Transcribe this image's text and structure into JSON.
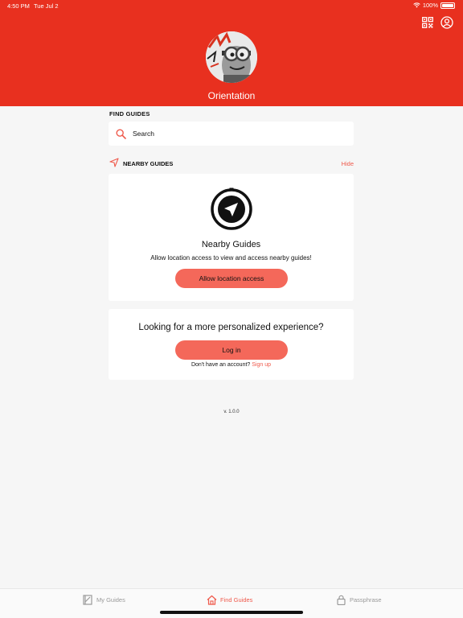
{
  "status_bar": {
    "time": "4:50 PM",
    "date": "Tue Jul 2",
    "battery": "100%"
  },
  "header": {
    "title": "Orientation",
    "accent_color": "#e8301f",
    "icons": [
      "qr-code-icon",
      "account-icon"
    ]
  },
  "find_guides": {
    "section_label": "FIND GUIDES",
    "search_placeholder": "Search"
  },
  "nearby": {
    "label": "NEARBY GUIDES",
    "hide_label": "Hide",
    "card_title": "Nearby Guides",
    "card_text": "Allow location access to view and access nearby guides!",
    "button_label": "Allow location access"
  },
  "login": {
    "title": "Looking for a more personalized experience?",
    "button_label": "Log in",
    "prompt": "Don't have an account?",
    "signup_label": "Sign up"
  },
  "version": "v. 1.0.0",
  "tabs": [
    {
      "label": "My Guides",
      "icon": "guide-book-icon",
      "active": false
    },
    {
      "label": "Find Guides",
      "icon": "home-icon",
      "active": true
    },
    {
      "label": "Passphrase",
      "icon": "lock-icon",
      "active": false
    }
  ]
}
